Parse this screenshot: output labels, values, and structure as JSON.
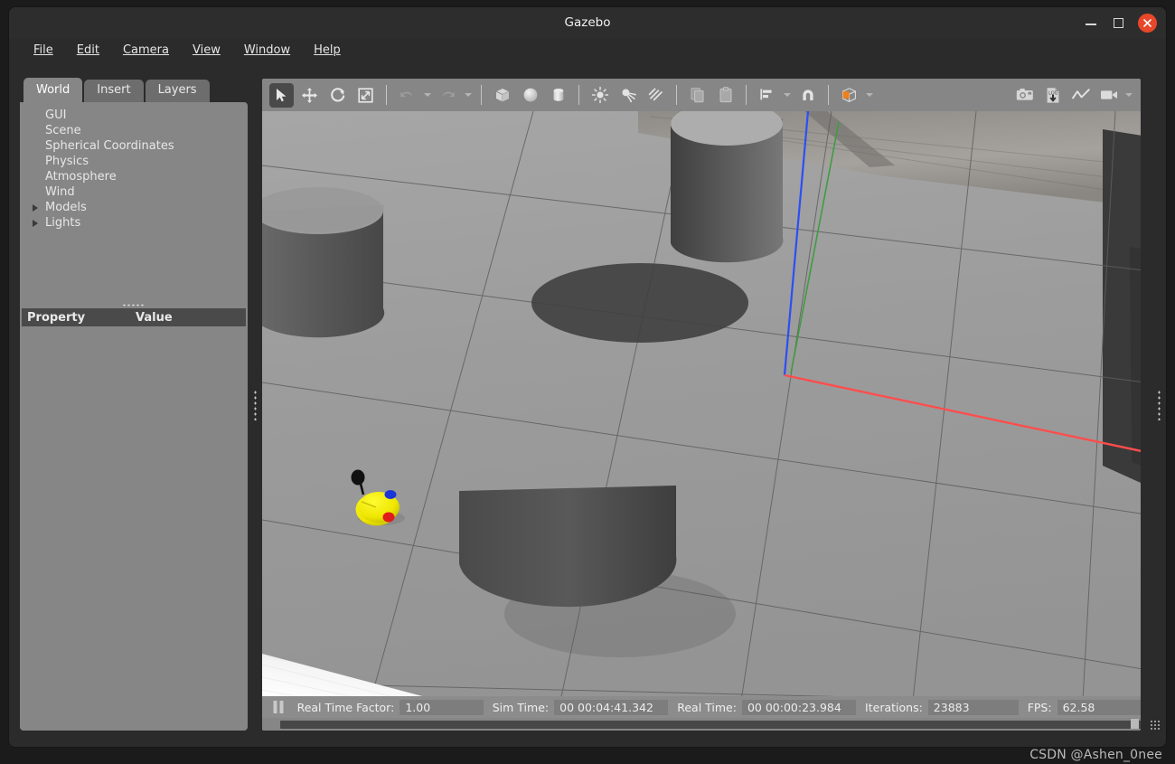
{
  "window": {
    "title": "Gazebo",
    "minimize_icon": "minimize-icon",
    "maximize_icon": "maximize-icon",
    "close_icon": "close-icon"
  },
  "menubar": {
    "items": [
      {
        "label": "File",
        "mnemonic": "F"
      },
      {
        "label": "Edit",
        "mnemonic": "E"
      },
      {
        "label": "Camera",
        "mnemonic": "C"
      },
      {
        "label": "View",
        "mnemonic": "V"
      },
      {
        "label": "Window",
        "mnemonic": "W"
      },
      {
        "label": "Help",
        "mnemonic": "H"
      }
    ]
  },
  "left_panel": {
    "tabs": [
      {
        "label": "World",
        "active": true
      },
      {
        "label": "Insert",
        "active": false
      },
      {
        "label": "Layers",
        "active": false
      }
    ],
    "tree_items": [
      {
        "label": "GUI",
        "expandable": false
      },
      {
        "label": "Scene",
        "expandable": false
      },
      {
        "label": "Spherical Coordinates",
        "expandable": false
      },
      {
        "label": "Physics",
        "expandable": false
      },
      {
        "label": "Atmosphere",
        "expandable": false
      },
      {
        "label": "Wind",
        "expandable": false
      },
      {
        "label": "Models",
        "expandable": true
      },
      {
        "label": "Lights",
        "expandable": true
      }
    ],
    "property_table": {
      "columns": [
        "Property",
        "Value"
      ],
      "rows": []
    }
  },
  "toolbar": {
    "groups": [
      {
        "buttons": [
          {
            "icon": "select-arrow-icon",
            "label": "Selection Mode",
            "active": true
          },
          {
            "icon": "translate-icon",
            "label": "Translation Mode",
            "active": false
          },
          {
            "icon": "rotate-icon",
            "label": "Rotation Mode",
            "active": false
          },
          {
            "icon": "scale-icon",
            "label": "Scale Mode",
            "active": false
          }
        ]
      },
      {
        "buttons": [
          {
            "icon": "undo-icon",
            "label": "Undo",
            "active": false,
            "caret": true
          },
          {
            "icon": "redo-icon",
            "label": "Redo",
            "active": false,
            "caret": true
          }
        ]
      },
      {
        "buttons": [
          {
            "icon": "box-icon",
            "label": "Insert Box",
            "active": false
          },
          {
            "icon": "sphere-icon",
            "label": "Insert Sphere",
            "active": false
          },
          {
            "icon": "cylinder-icon",
            "label": "Insert Cylinder",
            "active": false
          }
        ]
      },
      {
        "buttons": [
          {
            "icon": "point-light-icon",
            "label": "Insert Point Light",
            "active": false
          },
          {
            "icon": "spot-light-icon",
            "label": "Insert Spot Light",
            "active": false
          },
          {
            "icon": "directional-light-icon",
            "label": "Insert Directional Light",
            "active": false
          }
        ]
      },
      {
        "buttons": [
          {
            "icon": "copy-icon",
            "label": "Copy",
            "active": false
          },
          {
            "icon": "paste-icon",
            "label": "Paste",
            "active": false
          }
        ]
      },
      {
        "buttons": [
          {
            "icon": "align-icon",
            "label": "Align",
            "active": false,
            "caret": true
          },
          {
            "icon": "snap-icon",
            "label": "Snap",
            "active": false
          }
        ]
      },
      {
        "buttons": [
          {
            "icon": "view-cube-icon",
            "label": "Change View Angle",
            "active": false,
            "caret": true
          }
        ]
      }
    ],
    "right_buttons": [
      {
        "icon": "screenshot-camera-icon",
        "label": "Take Screenshot"
      },
      {
        "icon": "log-download-icon",
        "label": "Data Logger"
      },
      {
        "icon": "plot-icon",
        "label": "Plotting Utility"
      },
      {
        "icon": "video-record-icon",
        "label": "Record Video",
        "caret": true
      }
    ],
    "accent_color": "#ef8019"
  },
  "status_bar": {
    "pause_icon": "pause-icon",
    "fields": [
      {
        "label": "Real Time Factor:",
        "value": "1.00",
        "name": "real-time-factor"
      },
      {
        "label": "Sim Time:",
        "value": "00 00:04:41.342",
        "name": "sim-time"
      },
      {
        "label": "Real Time:",
        "value": "00 00:00:23.984",
        "name": "real-time"
      },
      {
        "label": "Iterations:",
        "value": "23883",
        "name": "iterations"
      },
      {
        "label": "FPS:",
        "value": "62.58",
        "name": "fps"
      }
    ]
  },
  "scene": {
    "description": "Gazebo 3D viewport with gray grid ground plane, three dark gray cylinders, a yellow two-wheeled robot model, and colored world axes",
    "axis_colors": {
      "x": "#ff4d4d",
      "y": "#4caf50",
      "z": "#2b4ff5"
    },
    "ground_color": "#9a9a9a",
    "grid_line_color": "#5f5f5f",
    "robot": {
      "body_color": "#f2e800",
      "marker_blue": "#1b35d8",
      "marker_red": "#e01b1b",
      "antenna_color": "#111111"
    }
  },
  "watermark": {
    "text": "CSDN @Ashen_0nee"
  }
}
